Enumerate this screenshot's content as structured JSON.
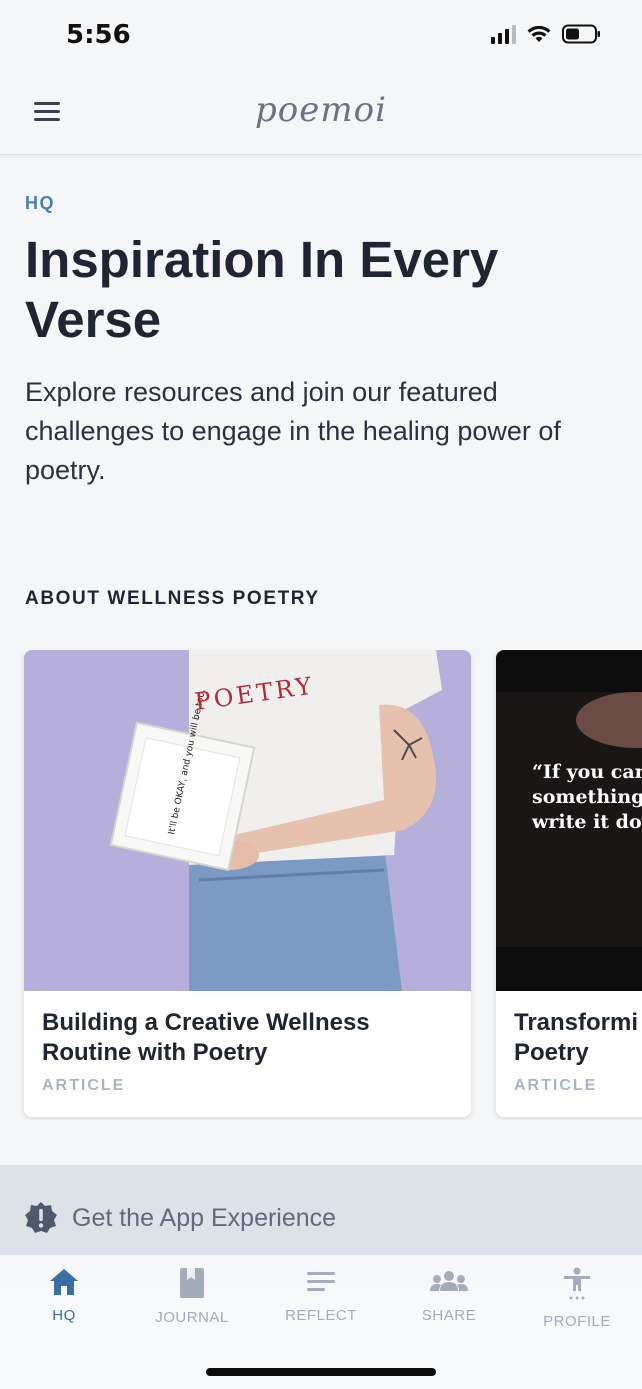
{
  "status": {
    "time": "5:56"
  },
  "app": {
    "brand": "poemoi"
  },
  "hero": {
    "eyebrow": "HQ",
    "title": "Inspiration In Every Verse",
    "description": "Explore resources and join our featured challenges to engage in the healing power of poetry."
  },
  "section": {
    "title": "ABOUT WELLNESS POETRY"
  },
  "cards": [
    {
      "title": "Building a Creative Wellness Routine with Poetry",
      "type": "ARTICLE",
      "image": {
        "shirt_text": "POETRY",
        "book_text": "It'll be OKAY, and you will be too."
      }
    },
    {
      "title": "Transformi\nPoetry",
      "type": "ARTICLE",
      "image": {
        "quote": "“If you can\nsomething c\nwrite it dow"
      }
    }
  ],
  "banner": {
    "text": "Get the App Experience"
  },
  "tabs": [
    {
      "label": "HQ",
      "icon": "home-icon",
      "active": true
    },
    {
      "label": "JOURNAL",
      "icon": "journal-icon",
      "active": false
    },
    {
      "label": "REFLECT",
      "icon": "reflect-icon",
      "active": false
    },
    {
      "label": "SHARE",
      "icon": "share-icon",
      "active": false
    },
    {
      "label": "PROFILE",
      "icon": "profile-icon",
      "active": false
    }
  ],
  "colors": {
    "accent": "#3b6fa3",
    "eyebrow": "#4a7fae",
    "text": "#1f2533",
    "muted": "#a3acba",
    "banner_bg": "#dde1e8"
  }
}
